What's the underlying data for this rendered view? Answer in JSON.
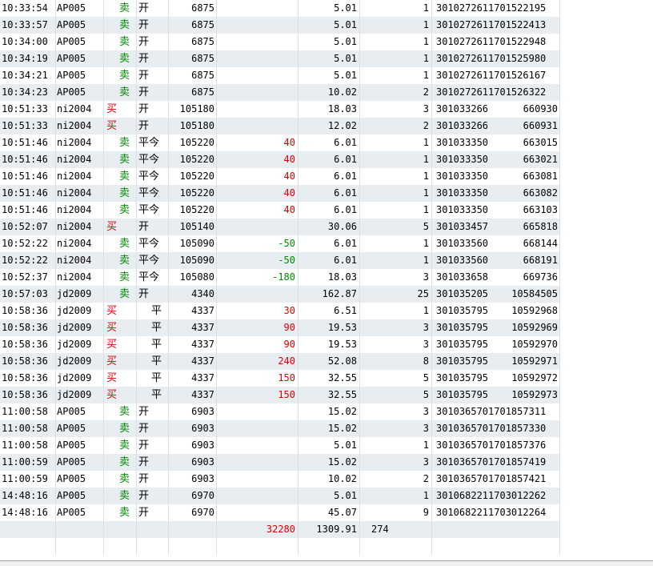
{
  "colors": {
    "buy": "#e00000",
    "sell": "#008800",
    "row_alt": "#e8edf1"
  },
  "rows": [
    {
      "time": "10:33:54",
      "code": "AP005",
      "dir": "卖",
      "oc": "开",
      "price": "6875",
      "pnl": "",
      "fee": "5.01",
      "qty": "1",
      "order": "3010272611701522195",
      "trade": ""
    },
    {
      "time": "10:33:57",
      "code": "AP005",
      "dir": "卖",
      "oc": "开",
      "price": "6875",
      "pnl": "",
      "fee": "5.01",
      "qty": "1",
      "order": "3010272611701522413",
      "trade": ""
    },
    {
      "time": "10:34:00",
      "code": "AP005",
      "dir": "卖",
      "oc": "开",
      "price": "6875",
      "pnl": "",
      "fee": "5.01",
      "qty": "1",
      "order": "3010272611701522948",
      "trade": ""
    },
    {
      "time": "10:34:19",
      "code": "AP005",
      "dir": "卖",
      "oc": "开",
      "price": "6875",
      "pnl": "",
      "fee": "5.01",
      "qty": "1",
      "order": "3010272611701525980",
      "trade": ""
    },
    {
      "time": "10:34:21",
      "code": "AP005",
      "dir": "卖",
      "oc": "开",
      "price": "6875",
      "pnl": "",
      "fee": "5.01",
      "qty": "1",
      "order": "3010272611701526167",
      "trade": ""
    },
    {
      "time": "10:34:23",
      "code": "AP005",
      "dir": "卖",
      "oc": "开",
      "price": "6875",
      "pnl": "",
      "fee": "10.02",
      "qty": "2",
      "order": "3010272611701526322",
      "trade": ""
    },
    {
      "time": "10:51:33",
      "code": "ni2004",
      "dir": "买",
      "oc": "开",
      "price": "105180",
      "pnl": "",
      "fee": "18.03",
      "qty": "3",
      "order": "301033266",
      "trade": "660930"
    },
    {
      "time": "10:51:33",
      "code": "ni2004",
      "dir": "买",
      "oc": "开",
      "price": "105180",
      "pnl": "",
      "fee": "12.02",
      "qty": "2",
      "order": "301033266",
      "trade": "660931"
    },
    {
      "time": "10:51:46",
      "code": "ni2004",
      "dir": "卖",
      "oc": "平今",
      "price": "105220",
      "pnl": "40",
      "fee": "6.01",
      "qty": "1",
      "order": "301033350",
      "trade": "663015"
    },
    {
      "time": "10:51:46",
      "code": "ni2004",
      "dir": "卖",
      "oc": "平今",
      "price": "105220",
      "pnl": "40",
      "fee": "6.01",
      "qty": "1",
      "order": "301033350",
      "trade": "663021"
    },
    {
      "time": "10:51:46",
      "code": "ni2004",
      "dir": "卖",
      "oc": "平今",
      "price": "105220",
      "pnl": "40",
      "fee": "6.01",
      "qty": "1",
      "order": "301033350",
      "trade": "663081"
    },
    {
      "time": "10:51:46",
      "code": "ni2004",
      "dir": "卖",
      "oc": "平今",
      "price": "105220",
      "pnl": "40",
      "fee": "6.01",
      "qty": "1",
      "order": "301033350",
      "trade": "663082"
    },
    {
      "time": "10:51:46",
      "code": "ni2004",
      "dir": "卖",
      "oc": "平今",
      "price": "105220",
      "pnl": "40",
      "fee": "6.01",
      "qty": "1",
      "order": "301033350",
      "trade": "663103"
    },
    {
      "time": "10:52:07",
      "code": "ni2004",
      "dir": "买",
      "oc": "开",
      "price": "105140",
      "pnl": "",
      "fee": "30.06",
      "qty": "5",
      "order": "301033457",
      "trade": "665818"
    },
    {
      "time": "10:52:22",
      "code": "ni2004",
      "dir": "卖",
      "oc": "平今",
      "price": "105090",
      "pnl": "-50",
      "fee": "6.01",
      "qty": "1",
      "order": "301033560",
      "trade": "668144"
    },
    {
      "time": "10:52:22",
      "code": "ni2004",
      "dir": "卖",
      "oc": "平今",
      "price": "105090",
      "pnl": "-50",
      "fee": "6.01",
      "qty": "1",
      "order": "301033560",
      "trade": "668191"
    },
    {
      "time": "10:52:37",
      "code": "ni2004",
      "dir": "卖",
      "oc": "平今",
      "price": "105080",
      "pnl": "-180",
      "fee": "18.03",
      "qty": "3",
      "order": "301033658",
      "trade": "669736"
    },
    {
      "time": "10:57:03",
      "code": "jd2009",
      "dir": "卖",
      "oc": "开",
      "price": "4340",
      "pnl": "",
      "fee": "162.87",
      "qty": "25",
      "order": "301035205",
      "trade": "10584505"
    },
    {
      "time": "10:58:36",
      "code": "jd2009",
      "dir": "买",
      "oc": "平",
      "price": "4337",
      "pnl": "30",
      "fee": "6.51",
      "qty": "1",
      "order": "301035795",
      "trade": "10592968"
    },
    {
      "time": "10:58:36",
      "code": "jd2009",
      "dir": "买",
      "oc": "平",
      "price": "4337",
      "pnl": "90",
      "fee": "19.53",
      "qty": "3",
      "order": "301035795",
      "trade": "10592969"
    },
    {
      "time": "10:58:36",
      "code": "jd2009",
      "dir": "买",
      "oc": "平",
      "price": "4337",
      "pnl": "90",
      "fee": "19.53",
      "qty": "3",
      "order": "301035795",
      "trade": "10592970"
    },
    {
      "time": "10:58:36",
      "code": "jd2009",
      "dir": "买",
      "oc": "平",
      "price": "4337",
      "pnl": "240",
      "fee": "52.08",
      "qty": "8",
      "order": "301035795",
      "trade": "10592971"
    },
    {
      "time": "10:58:36",
      "code": "jd2009",
      "dir": "买",
      "oc": "平",
      "price": "4337",
      "pnl": "150",
      "fee": "32.55",
      "qty": "5",
      "order": "301035795",
      "trade": "10592972"
    },
    {
      "time": "10:58:36",
      "code": "jd2009",
      "dir": "买",
      "oc": "平",
      "price": "4337",
      "pnl": "150",
      "fee": "32.55",
      "qty": "5",
      "order": "301035795",
      "trade": "10592973"
    },
    {
      "time": "11:00:58",
      "code": "AP005",
      "dir": "卖",
      "oc": "开",
      "price": "6903",
      "pnl": "",
      "fee": "15.02",
      "qty": "3",
      "order": "3010365701701857311",
      "trade": ""
    },
    {
      "time": "11:00:58",
      "code": "AP005",
      "dir": "卖",
      "oc": "开",
      "price": "6903",
      "pnl": "",
      "fee": "15.02",
      "qty": "3",
      "order": "3010365701701857330",
      "trade": ""
    },
    {
      "time": "11:00:58",
      "code": "AP005",
      "dir": "卖",
      "oc": "开",
      "price": "6903",
      "pnl": "",
      "fee": "5.01",
      "qty": "1",
      "order": "3010365701701857376",
      "trade": ""
    },
    {
      "time": "11:00:59",
      "code": "AP005",
      "dir": "卖",
      "oc": "开",
      "price": "6903",
      "pnl": "",
      "fee": "15.02",
      "qty": "3",
      "order": "3010365701701857419",
      "trade": ""
    },
    {
      "time": "11:00:59",
      "code": "AP005",
      "dir": "卖",
      "oc": "开",
      "price": "6903",
      "pnl": "",
      "fee": "10.02",
      "qty": "2",
      "order": "3010365701701857421",
      "trade": ""
    },
    {
      "time": "14:48:16",
      "code": "AP005",
      "dir": "卖",
      "oc": "开",
      "price": "6970",
      "pnl": "",
      "fee": "5.01",
      "qty": "1",
      "order": "3010682211703012262",
      "trade": ""
    },
    {
      "time": "14:48:16",
      "code": "AP005",
      "dir": "卖",
      "oc": "开",
      "price": "6970",
      "pnl": "",
      "fee": "45.07",
      "qty": "9",
      "order": "3010682211703012264",
      "trade": ""
    }
  ],
  "totals": {
    "pnl": "32280",
    "fee": "1309.91",
    "qty": "274"
  }
}
